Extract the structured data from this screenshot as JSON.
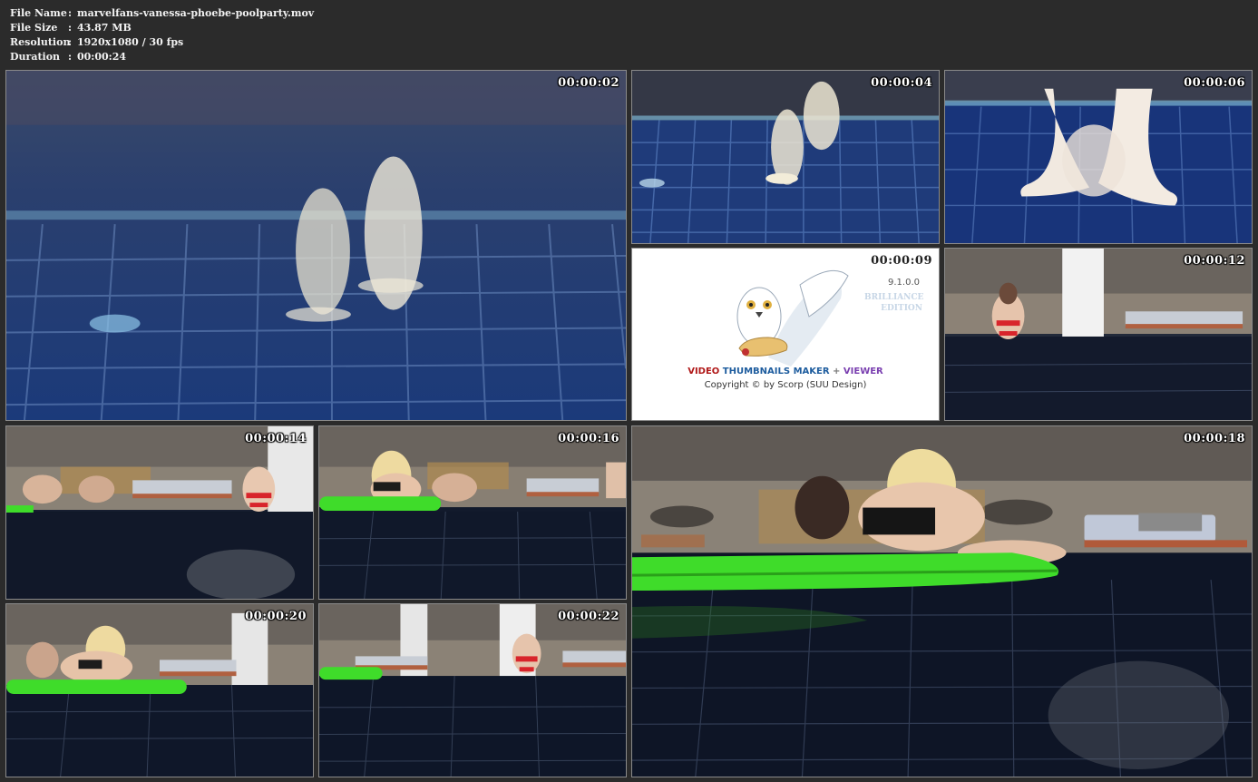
{
  "file_info": {
    "rows": [
      {
        "key": "File Name",
        "sep": ":",
        "value": "marvelfans-vanessa-phoebe-poolparty.mov"
      },
      {
        "key": "File Size",
        "sep": ":",
        "value": "43.87 MB"
      },
      {
        "key": "Resolution",
        "sep": ":",
        "value": "1920x1080 / 30 fps"
      },
      {
        "key": "Duration",
        "sep": ":",
        "value": "00:00:24"
      }
    ]
  },
  "thumbnails": [
    {
      "timestamp": "00:00:02",
      "scene": "underwater-legs"
    },
    {
      "timestamp": "00:00:04",
      "scene": "underwater-legs"
    },
    {
      "timestamp": "00:00:06",
      "scene": "underwater-feet"
    },
    {
      "timestamp": "00:00:09",
      "scene": "app-logo"
    },
    {
      "timestamp": "00:00:12",
      "scene": "poolside-person"
    },
    {
      "timestamp": "00:00:14",
      "scene": "poolside-group"
    },
    {
      "timestamp": "00:00:16",
      "scene": "poolside-group-float"
    },
    {
      "timestamp": "00:00:18",
      "scene": "poolside-float-closeup"
    },
    {
      "timestamp": "00:00:20",
      "scene": "poolside-group-float"
    },
    {
      "timestamp": "00:00:22",
      "scene": "poolside-person"
    }
  ],
  "logo": {
    "version": "9.1.0.0",
    "edition_line1": "BRILLIANCE",
    "edition_line2": "EDITION",
    "title_part1": "VIDEO",
    "title_part2": "THUMBNAILS MAKER",
    "title_part3": "+",
    "title_part4": "VIEWER",
    "copyright": "Copyright © by Scorp (SUU Design)"
  },
  "colors": {
    "background": "#2b2b2b",
    "pool_water": "#1b3a78",
    "float_green": "#3fdc2a",
    "bikini_red": "#d8242b"
  }
}
